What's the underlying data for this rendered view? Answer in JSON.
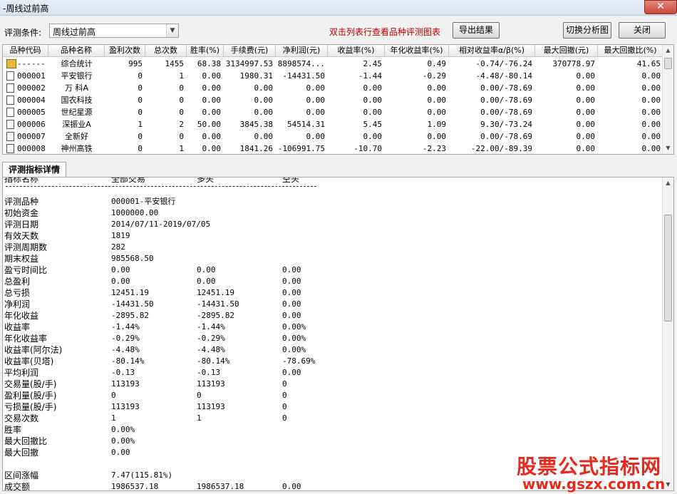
{
  "window": {
    "title": "-周线过前高",
    "close_glyph": "✕"
  },
  "toolbar": {
    "condition_label": "评测条件:",
    "condition_value": "周线过前高",
    "hint": "双击列表行查看品种评测图表",
    "export_label": "导出结果",
    "switch_label": "切换分析图",
    "close_label": "关闭"
  },
  "grid": {
    "columns": [
      "品种代码",
      "品种名称",
      "盈利次数",
      "总次数",
      "胜率(%)",
      "手续费(元)",
      "净利润(元)",
      "收益率(%)",
      "年化收益率(%)",
      "相对收益率α/β(%)",
      "最大回撤(元)",
      "最大回撤比(%)"
    ],
    "rows": [
      {
        "code": "------",
        "name": "综合统计",
        "wins": "995",
        "total": "1455",
        "winrate": "68.38",
        "fee": "3134997.53",
        "profit": "8898574...",
        "ret": "2.45",
        "annual": "0.49",
        "relative": "-0.74/-76.24",
        "maxdd": "370778.97",
        "maxddr": "41.65",
        "icon": "summary-icon"
      },
      {
        "code": "000001",
        "name": "平安银行",
        "wins": "0",
        "total": "1",
        "winrate": "0.00",
        "fee": "1980.31",
        "profit": "-14431.50",
        "ret": "-1.44",
        "annual": "-0.29",
        "relative": "-4.48/-80.14",
        "maxdd": "0.00",
        "maxddr": "0.00",
        "icon": "document-icon"
      },
      {
        "code": "000002",
        "name": "万 科A",
        "wins": "0",
        "total": "0",
        "winrate": "0.00",
        "fee": "0.00",
        "profit": "0.00",
        "ret": "0.00",
        "annual": "0.00",
        "relative": "0.00/-78.69",
        "maxdd": "0.00",
        "maxddr": "0.00",
        "icon": "document-icon"
      },
      {
        "code": "000004",
        "name": "国农科技",
        "wins": "0",
        "total": "0",
        "winrate": "0.00",
        "fee": "0.00",
        "profit": "0.00",
        "ret": "0.00",
        "annual": "0.00",
        "relative": "0.00/-78.69",
        "maxdd": "0.00",
        "maxddr": "0.00",
        "icon": "document-icon"
      },
      {
        "code": "000005",
        "name": "世纪星源",
        "wins": "0",
        "total": "0",
        "winrate": "0.00",
        "fee": "0.00",
        "profit": "0.00",
        "ret": "0.00",
        "annual": "0.00",
        "relative": "0.00/-78.69",
        "maxdd": "0.00",
        "maxddr": "0.00",
        "icon": "document-icon"
      },
      {
        "code": "000006",
        "name": "深振业A",
        "wins": "1",
        "total": "2",
        "winrate": "50.00",
        "fee": "3845.38",
        "profit": "54514.31",
        "ret": "5.45",
        "annual": "1.09",
        "relative": "9.30/-73.24",
        "maxdd": "0.00",
        "maxddr": "0.00",
        "icon": "document-icon"
      },
      {
        "code": "000007",
        "name": "全新好",
        "wins": "0",
        "total": "0",
        "winrate": "0.00",
        "fee": "0.00",
        "profit": "0.00",
        "ret": "0.00",
        "annual": "0.00",
        "relative": "0.00/-78.69",
        "maxdd": "0.00",
        "maxddr": "0.00",
        "icon": "document-icon"
      },
      {
        "code": "000008",
        "name": "神州高铁",
        "wins": "0",
        "total": "1",
        "winrate": "0.00",
        "fee": "1841.26",
        "profit": "-106991.75",
        "ret": "-10.70",
        "annual": "-2.23",
        "relative": "-22.00/-89.39",
        "maxdd": "0.00",
        "maxddr": "0.00",
        "icon": "document-icon"
      }
    ]
  },
  "detail": {
    "tab_label": "评测指标详情",
    "header": [
      "指标名称",
      "全部交易",
      "多头",
      "空头"
    ],
    "rows": [
      [
        "评测品种",
        "000001-平安银行",
        "",
        ""
      ],
      [
        "初始资金",
        "1000000.00",
        "",
        ""
      ],
      [
        "评测日期",
        "2014/07/11-2019/07/05",
        "",
        ""
      ],
      [
        "有效天数",
        "1819",
        "",
        ""
      ],
      [
        "评测周期数",
        "282",
        "",
        ""
      ],
      [
        "期末权益",
        "985568.50",
        "",
        ""
      ],
      [
        "盈亏时间比",
        "0.00",
        "0.00",
        "0.00"
      ],
      [
        "总盈利",
        "0.00",
        "0.00",
        "0.00"
      ],
      [
        "总亏损",
        "12451.19",
        "12451.19",
        "0.00"
      ],
      [
        "净利润",
        "-14431.50",
        "-14431.50",
        "0.00"
      ],
      [
        "年化收益",
        "-2895.82",
        "-2895.82",
        "0.00"
      ],
      [
        "收益率",
        "-1.44%",
        "-1.44%",
        "0.00%"
      ],
      [
        "年化收益率",
        "-0.29%",
        "-0.29%",
        "0.00%"
      ],
      [
        "收益率(阿尔法)",
        "-4.48%",
        "-4.48%",
        "0.00%"
      ],
      [
        "收益率(贝塔)",
        "-80.14%",
        "-80.14%",
        "-78.69%"
      ],
      [
        "平均利润",
        "-0.13",
        "-0.13",
        "0.00"
      ],
      [
        "交易量(股/手)",
        "113193",
        "113193",
        "0"
      ],
      [
        "盈利量(股/手)",
        "0",
        "0",
        "0"
      ],
      [
        "亏损量(股/手)",
        "113193",
        "113193",
        "0"
      ],
      [
        "交易次数",
        "1",
        "1",
        "0"
      ],
      [
        "胜率",
        "0.00%",
        "",
        ""
      ],
      [
        "最大回撤比",
        "0.00%",
        "",
        ""
      ],
      [
        "最大回撤",
        "0.00",
        "",
        ""
      ],
      [
        "",
        "",
        "",
        ""
      ],
      [
        "区间涨幅",
        "7.47(115.81%)",
        "",
        ""
      ],
      [
        "成交额",
        "1986537.18",
        "1986537.18",
        "0.00"
      ]
    ]
  },
  "watermark": {
    "text": "股票公式指标网",
    "url": "www.gszx.com.cn"
  }
}
